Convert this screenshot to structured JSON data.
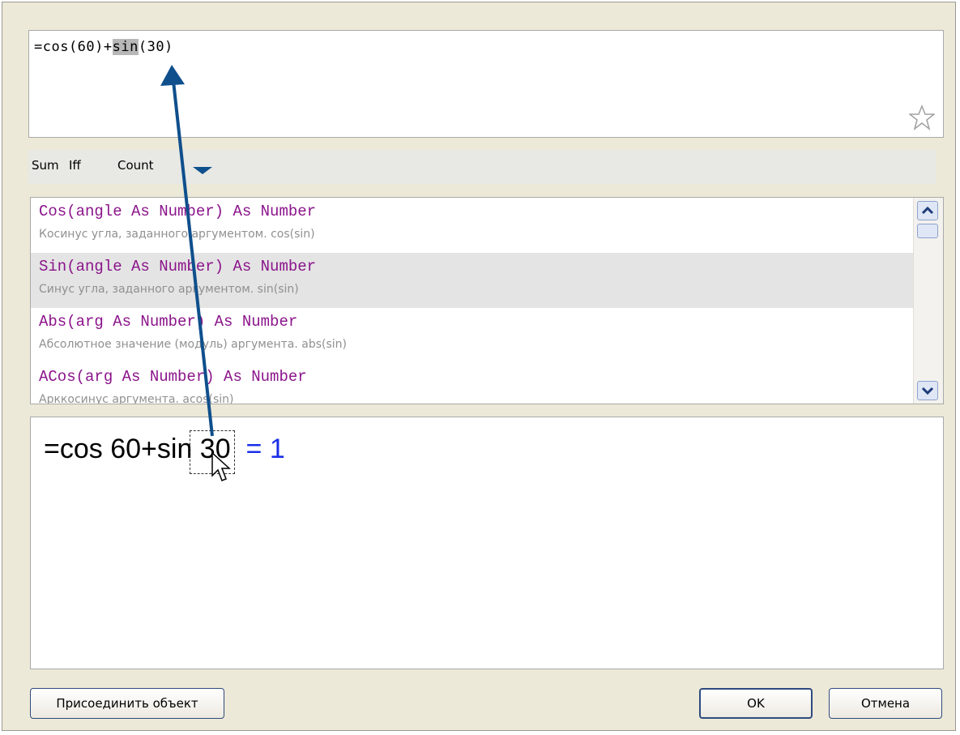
{
  "formula": {
    "before": "=cos(60)+",
    "selected": "sin",
    "after": "(30)"
  },
  "quick_functions": [
    "Sum",
    "Iff",
    "Count"
  ],
  "functions": [
    {
      "signature": "Cos(angle As Number) As Number",
      "description": "Косинус угла, заданного аргументом. cos(sin)"
    },
    {
      "signature": "Sin(angle As Number) As Number",
      "description": "Синус угла, заданного аргументом. sin(sin)"
    },
    {
      "signature": "Abs(arg As Number) As Number",
      "description": "Абсолютное значение (модуль) аргумента. abs(sin)"
    },
    {
      "signature": "ACos(arg As Number) As Number",
      "description": "Арккосинус аргумента. acos(sin)"
    }
  ],
  "selected_function_index": 1,
  "preview": {
    "expr_before": "=cos 60+",
    "expr_highlight": "sin",
    "expr_after": " 30  ",
    "result": "= 1"
  },
  "buttons": {
    "attach": "Присоединить объект",
    "ok": "OK",
    "cancel": "Отмена"
  },
  "colors": {
    "signature": "#8b148b",
    "description": "#909090",
    "result": "#1a2ee8",
    "arrow": "#0f4f8c",
    "selection": "#b8b8b8"
  },
  "icons": {
    "favorite": "star-icon",
    "more": "chevron-down-icon",
    "scroll_up": "arrow-up-icon",
    "scroll_down": "arrow-down-icon",
    "pointer": "mouse-cursor-icon"
  }
}
